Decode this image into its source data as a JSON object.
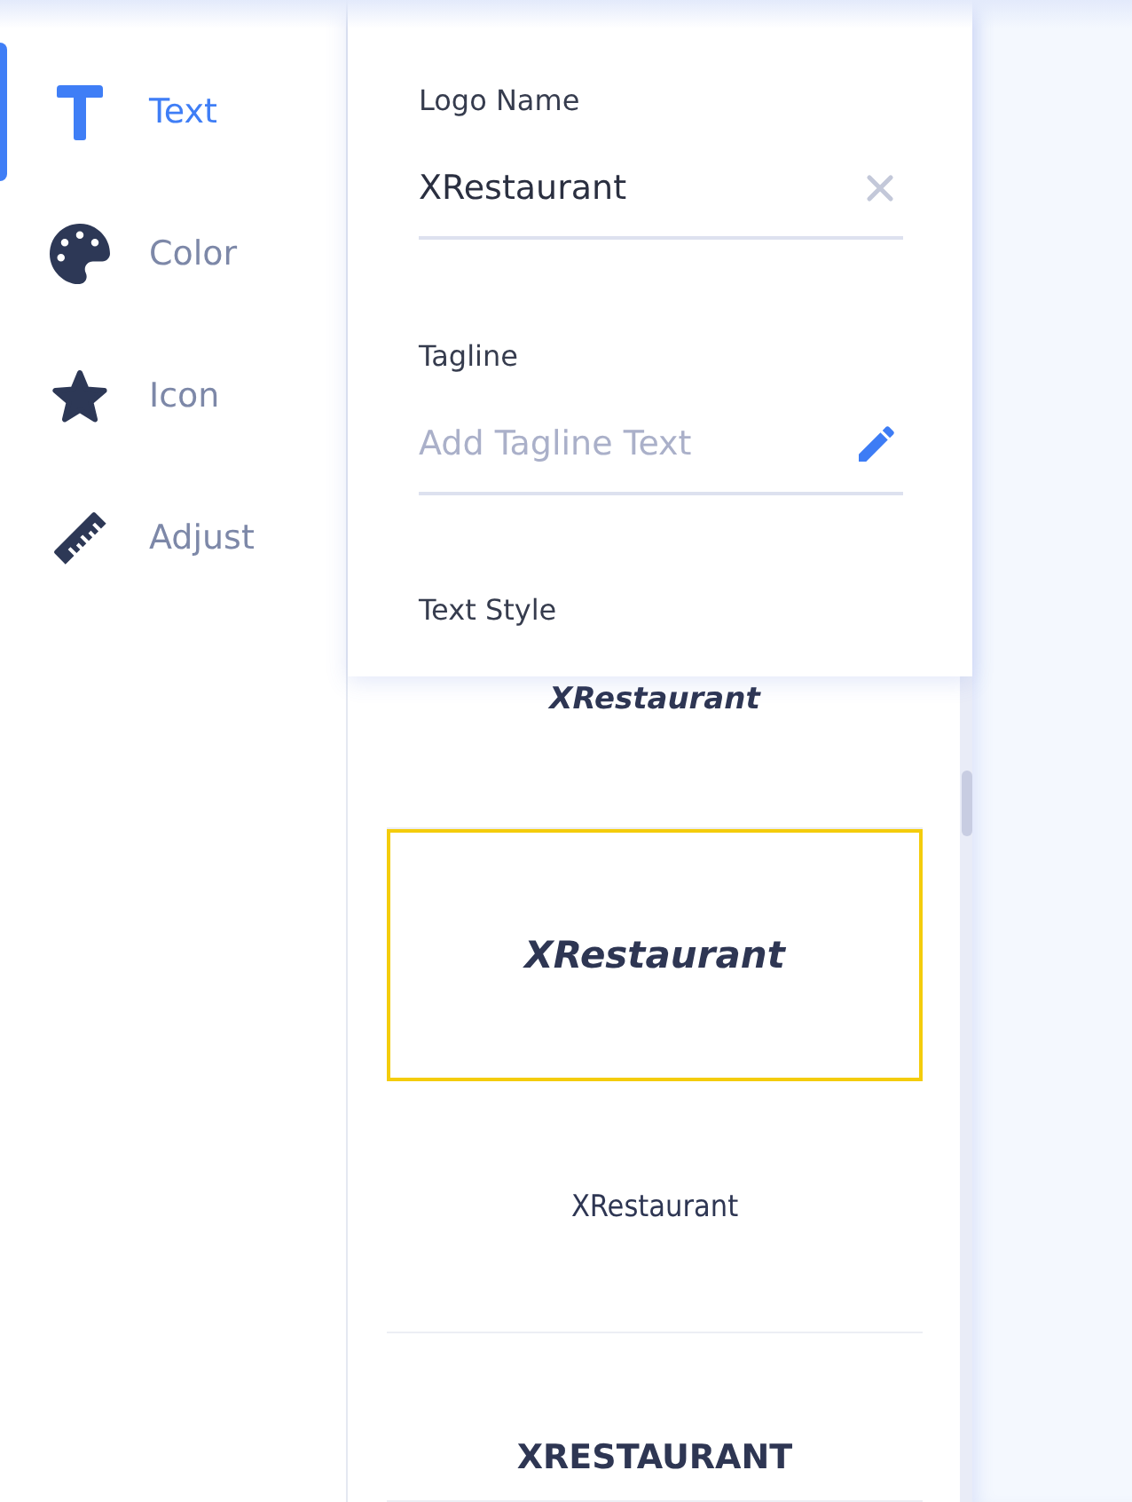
{
  "sidebar": {
    "items": [
      {
        "label": "Text",
        "selected": true
      },
      {
        "label": "Color",
        "selected": false
      },
      {
        "label": "Icon",
        "selected": false
      },
      {
        "label": "Adjust",
        "selected": false
      }
    ]
  },
  "text_panel": {
    "logo_name": {
      "label": "Logo Name",
      "value": "XRestaurant"
    },
    "tagline": {
      "label": "Tagline",
      "placeholder": "Add Tagline Text"
    },
    "text_style": {
      "label": "Text Style"
    }
  },
  "text_styles": [
    {
      "text": "XRestaurant",
      "kind": "italic",
      "selected": false
    },
    {
      "text": "XRestaurant",
      "kind": "bold-italic",
      "selected": true
    },
    {
      "text": "XRestaurant",
      "kind": "condensed",
      "selected": false
    },
    {
      "text": "XRESTAURANT",
      "kind": "heavy",
      "selected": false
    }
  ]
}
